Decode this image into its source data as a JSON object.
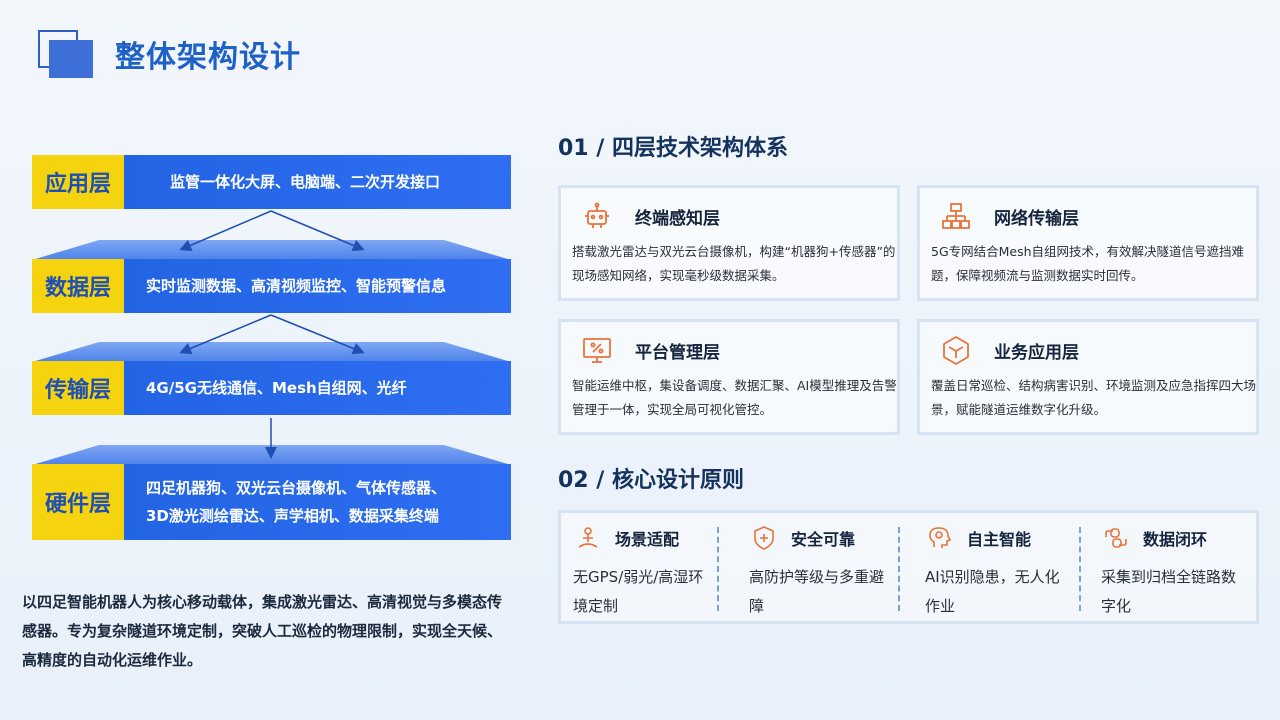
{
  "header": {
    "title": "整体架构设计"
  },
  "layers": [
    {
      "tag": "应用层",
      "text_lines": [
        "监管一体化大屏、电脑端、二次开发接口"
      ]
    },
    {
      "tag": "数据层",
      "text_lines": [
        "实时监测数据、高清视频监控、智能预警信息"
      ]
    },
    {
      "tag": "传输层",
      "text_lines": [
        "4G/5G无线通信、Mesh自组网、光纤"
      ]
    },
    {
      "tag": "硬件层",
      "text_lines": [
        "四足机器狗、双光云台摄像机、气体传感器、",
        "3D激光测绘雷达、声学相机、数据采集终端"
      ]
    }
  ],
  "intro": "以四足智能机器人为核心移动载体，集成激光雷达、高清视觉与多模态传感器。专为复杂隧道环境定制，突破人工巡检的物理限制，实现全天候、高精度的自动化运维作业。",
  "section1": {
    "title": "01 / 四层技术架构体系",
    "cards": [
      {
        "icon": "robot-icon",
        "title": "终端感知层",
        "desc": "搭载激光雷达与双光云台摄像机，构建“机器狗+传感器”的现场感知网络，实现毫秒级数据采集。"
      },
      {
        "icon": "network-icon",
        "title": "网络传输层",
        "desc": "5G专网结合Mesh自组网技术，有效解决隧道信号遮挡难题，保障视频流与监测数据实时回传。"
      },
      {
        "icon": "monitor-percent-icon",
        "title": "平台管理层",
        "desc": "智能运维中枢，集设备调度、数据汇聚、AI模型推理及告警管理于一体，实现全局可视化管控。"
      },
      {
        "icon": "cube-icon",
        "title": "业务应用层",
        "desc": "覆盖日常巡检、结构病害识别、环境监测及应急指挥四大场景，赋能隧道运维数字化升级。"
      }
    ]
  },
  "section2": {
    "title": "02 / 核心设计原则",
    "principles": [
      {
        "icon": "person-location-icon",
        "title": "场景适配",
        "desc": "无GPS/弱光/高湿环境定制"
      },
      {
        "icon": "shield-plus-icon",
        "title": "安全可靠",
        "desc": "高防护等级与多重避障"
      },
      {
        "icon": "brain-icon",
        "title": "自主智能",
        "desc": "AI识别隐患，无人化作业"
      },
      {
        "icon": "loop-icon",
        "title": "数据闭环",
        "desc": "采集到归档全链路数字化"
      }
    ]
  },
  "colors": {
    "accent": "#1e62c7",
    "bar": "#2563eb",
    "tag": "#f5d40f",
    "icon": "#e8743b"
  }
}
